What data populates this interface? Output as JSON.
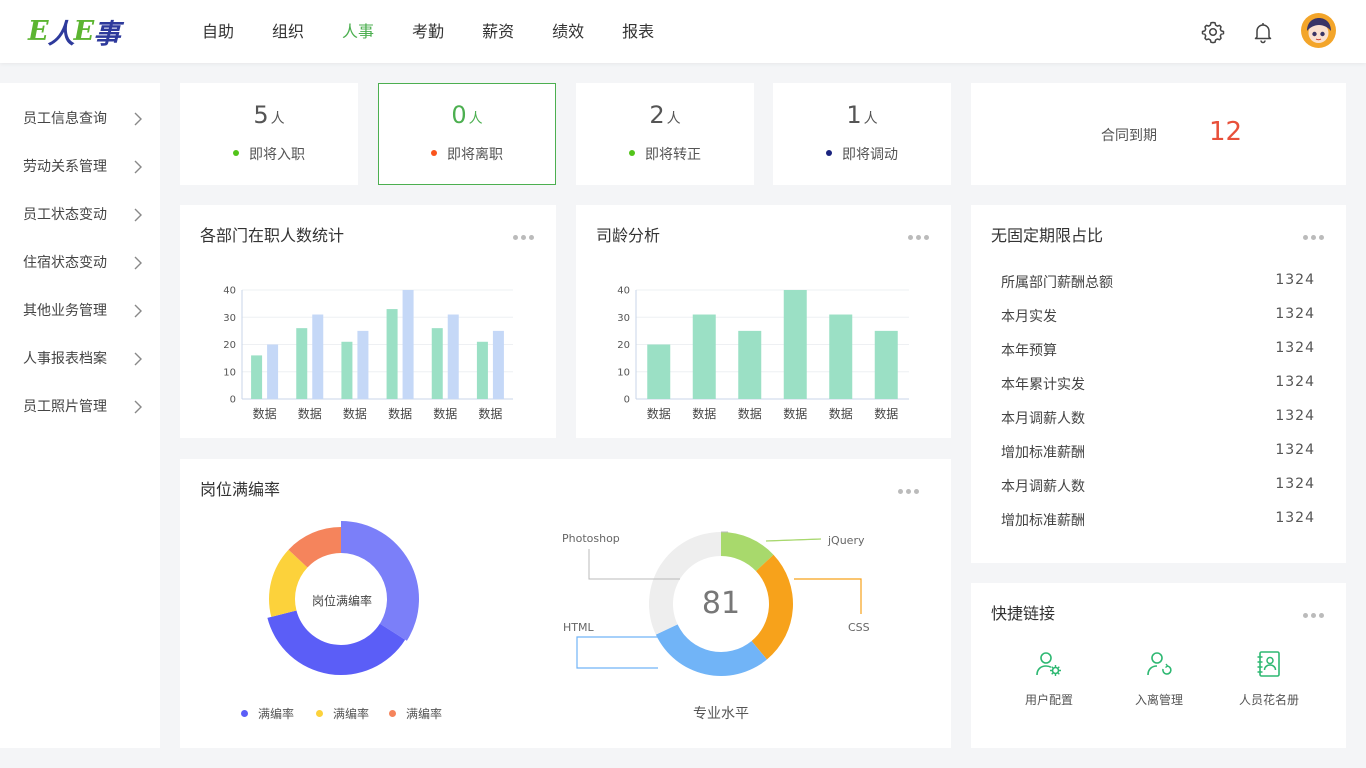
{
  "header": {
    "logo_parts": [
      "E",
      "人",
      "E",
      "事"
    ],
    "nav": [
      "自助",
      "组织",
      "人事",
      "考勤",
      "薪资",
      "绩效",
      "报表"
    ],
    "active_nav": "人事"
  },
  "sidebar": {
    "items": [
      "员工信息查询",
      "劳动关系管理",
      "员工状态变动",
      "住宿状态变动",
      "其他业务管理",
      "人事报表档案",
      "员工照片管理"
    ]
  },
  "stats": [
    {
      "value": "5",
      "unit": "人",
      "label": "即将入职",
      "color": "#52c41a"
    },
    {
      "value": "0",
      "unit": "人",
      "label": "即将离职",
      "color": "#fa541c"
    },
    {
      "value": "2",
      "unit": "人",
      "label": "即将转正",
      "color": "#52c41a"
    },
    {
      "value": "1",
      "unit": "人",
      "label": "即将调动",
      "color": "#1a237e"
    }
  ],
  "contract": {
    "label": "合同到期",
    "value": "12"
  },
  "dept_chart": {
    "title": "各部门在职人数统计"
  },
  "tenure_chart": {
    "title": "司龄分析"
  },
  "fill_rate": {
    "title": "岗位满编率",
    "donut_center": "岗位满编率",
    "legend": [
      "满编率",
      "满编率",
      "满编率"
    ],
    "skills_center": "81",
    "skills_caption": "专业水平",
    "skill_labels": [
      "Photoshop",
      "jQuery",
      "HTML",
      "CSS"
    ]
  },
  "nonfixed": {
    "title": "无固定期限占比",
    "rows": [
      {
        "k": "所属部门薪酬总额",
        "v": "1324"
      },
      {
        "k": "本月实发",
        "v": "1324"
      },
      {
        "k": "本年预算",
        "v": "1324"
      },
      {
        "k": "本年累计实发",
        "v": "1324"
      },
      {
        "k": "本月调薪人数",
        "v": "1324"
      },
      {
        "k": "增加标准薪酬",
        "v": "1324"
      },
      {
        "k": "本月调薪人数",
        "v": "1324"
      },
      {
        "k": "增加标准薪酬",
        "v": "1324"
      }
    ]
  },
  "quick_links": {
    "title": "快捷链接",
    "items": [
      {
        "label": "用户配置",
        "icon": "user-config-icon"
      },
      {
        "label": "入离管理",
        "icon": "user-entry-exit-icon"
      },
      {
        "label": "人员花名册",
        "icon": "roster-book-icon"
      }
    ]
  },
  "colors": {
    "accent": "#4caf50",
    "green_bar": "#9be0c5",
    "blue_bar": "#c5d8f7",
    "contract_value": "#e8503a",
    "donut": [
      "#7b7ff9",
      "#5b5ef7",
      "#fcd23b",
      "#f5845c"
    ],
    "skills": [
      "#a8d96c",
      "#f7a21b",
      "#71b4f7",
      "#eeeeee"
    ]
  },
  "chart_data": [
    {
      "type": "bar",
      "categories": [
        "数据",
        "数据",
        "数据",
        "数据",
        "数据",
        "数据"
      ],
      "series": [
        {
          "values": [
            16,
            26,
            21,
            33,
            26,
            21
          ]
        },
        {
          "values": [
            20,
            31,
            25,
            40,
            31,
            25
          ]
        }
      ],
      "yticks": [
        0,
        10,
        20,
        30,
        40
      ],
      "ylim": [
        0,
        40
      ]
    },
    {
      "type": "bar",
      "categories": [
        "数据",
        "数据",
        "数据",
        "数据",
        "数据",
        "数据"
      ],
      "series": [
        {
          "values": [
            20,
            31,
            25,
            40,
            31,
            25
          ]
        }
      ],
      "yticks": [
        0,
        10,
        20,
        30,
        40
      ],
      "ylim": [
        0,
        40
      ]
    },
    {
      "type": "pie",
      "labels": [
        "满编率",
        "满编率",
        "满编率",
        "满编率"
      ],
      "values": [
        34,
        37,
        16,
        13
      ]
    },
    {
      "type": "pie",
      "labels": [
        "jQuery",
        "CSS",
        "HTML",
        "Photoshop"
      ],
      "values": [
        13,
        26,
        29,
        32
      ]
    }
  ]
}
